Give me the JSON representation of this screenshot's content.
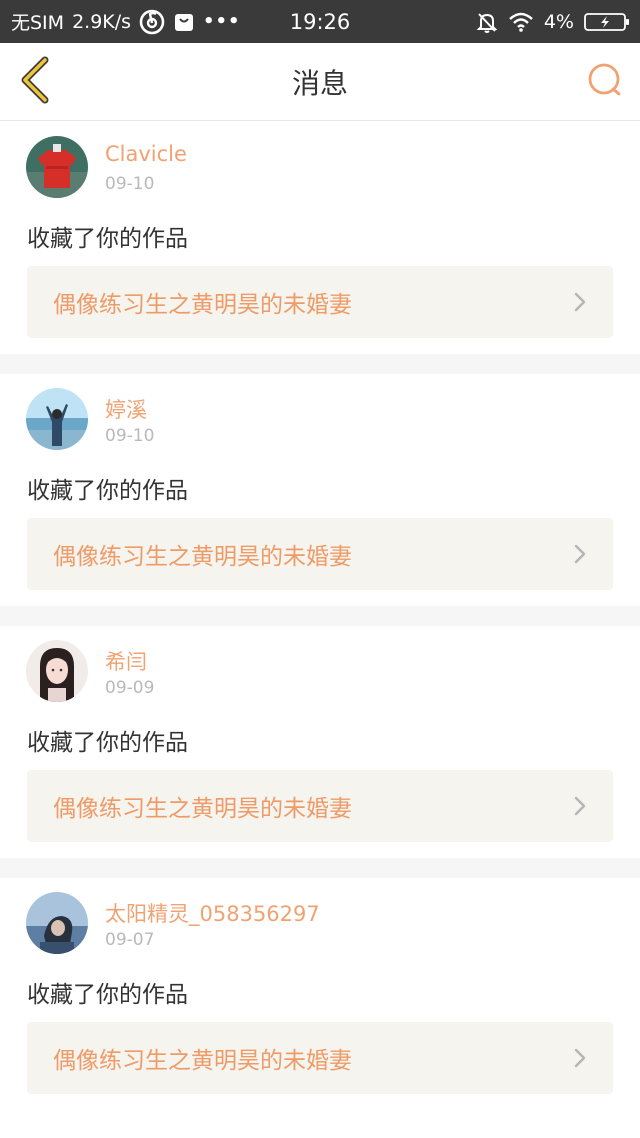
{
  "status_bar": {
    "carrier": "无SIM",
    "speed": "2.9K/s",
    "time": "19:26",
    "battery_percent": "4%",
    "icons": [
      "netease-music-icon",
      "shopping-bag-icon",
      "more-dots-icon",
      "mute-bell-icon",
      "wifi-icon",
      "battery-charging-icon"
    ]
  },
  "nav": {
    "title": "消息",
    "back_icon": "chevron-left-icon",
    "search_icon": "search-icon",
    "accent_color": "#f0a272"
  },
  "messages": [
    {
      "username": "Clavicle",
      "date": "09-10",
      "action": "收藏了你的作品",
      "work_title": "偶像练习生之黄明昊的未婚妻"
    },
    {
      "username": "婷溪",
      "date": "09-10",
      "action": "收藏了你的作品",
      "work_title": "偶像练习生之黄明昊的未婚妻"
    },
    {
      "username": "希闫",
      "date": "09-09",
      "action": "收藏了你的作品",
      "work_title": "偶像练习生之黄明昊的未婚妻"
    },
    {
      "username": "太阳精灵_058356297",
      "date": "09-07",
      "action": "收藏了你的作品",
      "work_title": "偶像练习生之黄明昊的未婚妻"
    }
  ]
}
